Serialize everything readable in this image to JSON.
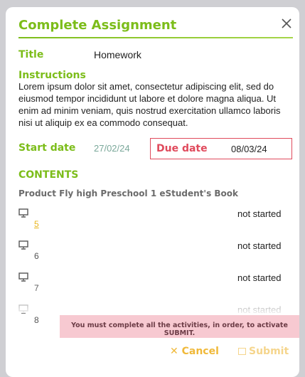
{
  "dialog": {
    "title": "Complete Assignment",
    "close_icon": "close-icon"
  },
  "fields": {
    "title_label": "Title",
    "title_value": "Homework",
    "instructions_label": "Instructions",
    "instructions_text": "Lorem ipsum dolor sit amet, consectetur adipiscing elit, sed do eiusmod tempor incididunt ut labore et dolore magna aliqua. Ut enim ad minim veniam, quis nostrud exercitation ullamco laboris nisi ut aliquip ex ea commodo consequat.",
    "start_label": "Start date",
    "start_value": "27/02/24",
    "due_label": "Due date",
    "due_value": "08/03/24"
  },
  "contents": {
    "label": "CONTENTS",
    "product": "Product Fly high Preschool 1 eStudent's Book",
    "items": [
      {
        "number": "5",
        "status": "not started",
        "icon": "monitor-icon"
      },
      {
        "number": "6",
        "status": "not started",
        "icon": "monitor-icon"
      },
      {
        "number": "7",
        "status": "not started",
        "icon": "monitor-icon"
      },
      {
        "number": "8",
        "status": "not started",
        "icon": "monitor-icon"
      }
    ]
  },
  "notice": "You must complete all the activities, in order, to activate SUBMIT.",
  "actions": {
    "cancel": "Cancel",
    "submit": "Submit"
  },
  "colors": {
    "accent": "#7cbd1a",
    "due": "#e04a5c",
    "cancel": "#f0b93a",
    "notice_bg": "#f7c9d1"
  }
}
